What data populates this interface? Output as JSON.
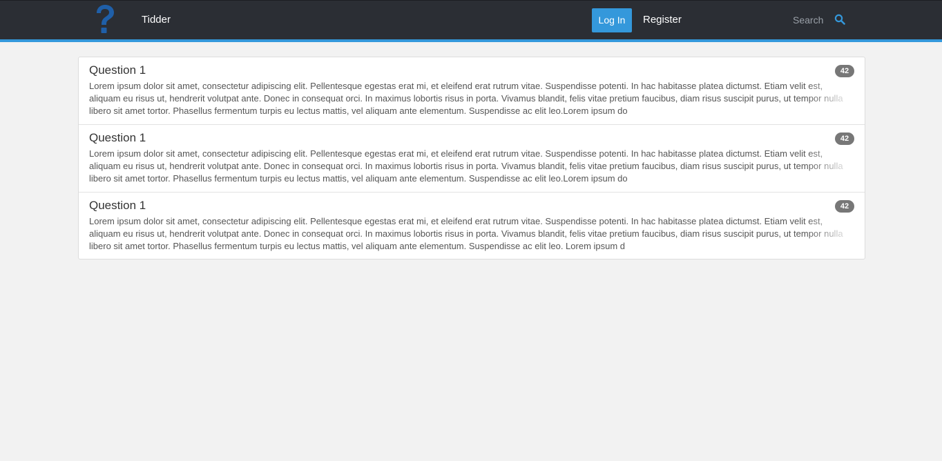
{
  "navbar": {
    "brand": "Tidder",
    "logo_icon": "question-mark-icon",
    "login_label": "Log In",
    "register_label": "Register",
    "search_placeholder": "Search",
    "search_icon": "search-icon",
    "colors": {
      "bar": "#2b2e34",
      "accent": "#3498db",
      "logo": "#1f5fa8"
    }
  },
  "questions": [
    {
      "title": "Question 1",
      "count": "42",
      "body": "Lorem ipsum dolor sit amet, consectetur adipiscing elit. Pellentesque egestas erat mi, et eleifend erat rutrum vitae. Suspendisse potenti. In hac habitasse platea dictumst. Etiam velit est, aliquam eu risus ut, hendrerit volutpat ante. Donec in consequat orci. In maximus lobortis risus in porta. Vivamus blandit, felis vitae pretium faucibus, diam risus suscipit purus, ut tempor nulla libero sit amet tortor. Phasellus fermentum turpis eu lectus mattis, vel aliquam ante elementum. Suspendisse ac elit leo.Lorem ipsum do"
    },
    {
      "title": "Question 1",
      "count": "42",
      "body": "Lorem ipsum dolor sit amet, consectetur adipiscing elit. Pellentesque egestas erat mi, et eleifend erat rutrum vitae. Suspendisse potenti. In hac habitasse platea dictumst. Etiam velit est, aliquam eu risus ut, hendrerit volutpat ante. Donec in consequat orci. In maximus lobortis risus in porta. Vivamus blandit, felis vitae pretium faucibus, diam risus suscipit purus, ut tempor nulla libero sit amet tortor. Phasellus fermentum turpis eu lectus mattis, vel aliquam ante elementum. Suspendisse ac elit leo.Lorem ipsum do"
    },
    {
      "title": "Question 1",
      "count": "42",
      "body": "Lorem ipsum dolor sit amet, consectetur adipiscing elit. Pellentesque egestas erat mi, et eleifend erat rutrum vitae. Suspendisse potenti. In hac habitasse platea dictumst. Etiam velit est, aliquam eu risus ut, hendrerit volutpat ante. Donec in consequat orci. In maximus lobortis risus in porta. Vivamus blandit, felis vitae pretium faucibus, diam risus suscipit purus, ut tempor nulla libero sit amet tortor. Phasellus fermentum turpis eu lectus mattis, vel aliquam ante elementum. Suspendisse ac elit leo. Lorem ipsum d"
    }
  ]
}
